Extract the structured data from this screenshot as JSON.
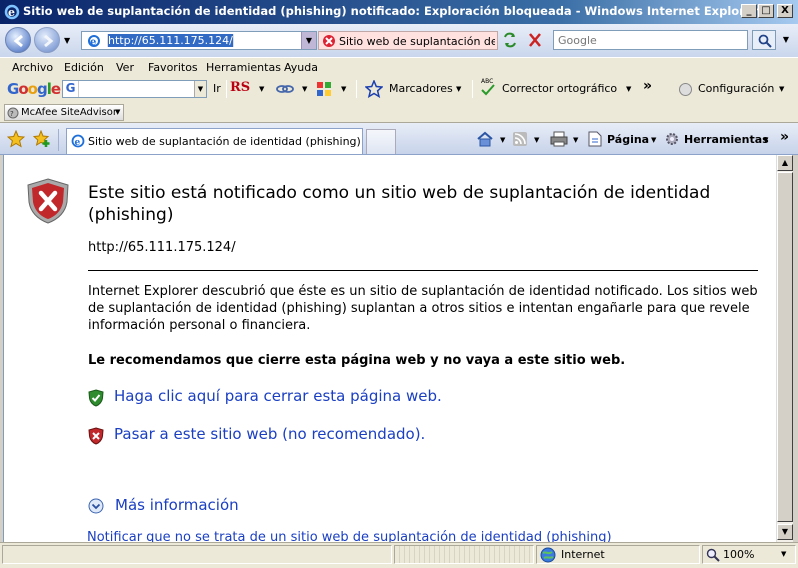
{
  "window": {
    "title": "Sitio web de suplantación de identidad (phishing) notificado: Exploración bloqueada - Windows Internet Explorer",
    "min_label": "_",
    "max_label": "□",
    "close_label": "X"
  },
  "address_bar": {
    "url": "http://65.111.175.124/",
    "phishing_indicator": "Sitio web de suplantación de identidad (phishing) notificado",
    "search_placeholder": "Google"
  },
  "menu": [
    "Archivo",
    "Edición",
    "Ver",
    "Favoritos",
    "Herramientas",
    "Ayuda"
  ],
  "google_toolbar": {
    "logo": "Google",
    "search_label": "G",
    "item_ir": "Ir",
    "item_rs": "RS",
    "bookmarks": "Marcadores",
    "spellcheck": "Corrector ortográfico",
    "spell_abc": "ABC",
    "more": "»",
    "settings": "Configuración"
  },
  "mcafee": {
    "label": "McAfee SiteAdvisor"
  },
  "tabs": [
    {
      "label": "Sitio web de suplantación de identidad (phishing) notific..."
    }
  ],
  "command_bar": {
    "page": "Página",
    "tools": "Herramientas",
    "more": "»"
  },
  "content": {
    "heading": "Este sitio está notificado como un sitio web de suplantación de identidad (phishing)",
    "url": "http://65.111.175.124/",
    "description": "Internet Explorer descubrió que éste es un sitio de suplantación de identidad notificado. Los sitios web de suplantación de identidad (phishing) suplantan a otros sitios e intentan engañarle para que revele información personal o financiera.",
    "recommendation": "Le recomendamos que cierre esta página web y no vaya a este sitio web.",
    "close_link": "Haga clic aquí para cerrar esta página web.",
    "continue_link": "Pasar a este sitio web (no recomendado).",
    "more_info": "Más información",
    "report_link": "Notificar que no se trata de un sitio web de suplantación de identidad (phishing)"
  },
  "status_bar": {
    "zone": "Internet",
    "zoom": "100%"
  },
  "colors": {
    "titlebar": "#0a246a",
    "link": "#1a3fc2",
    "danger": "#c0282c",
    "safe": "#2e8b2e"
  }
}
